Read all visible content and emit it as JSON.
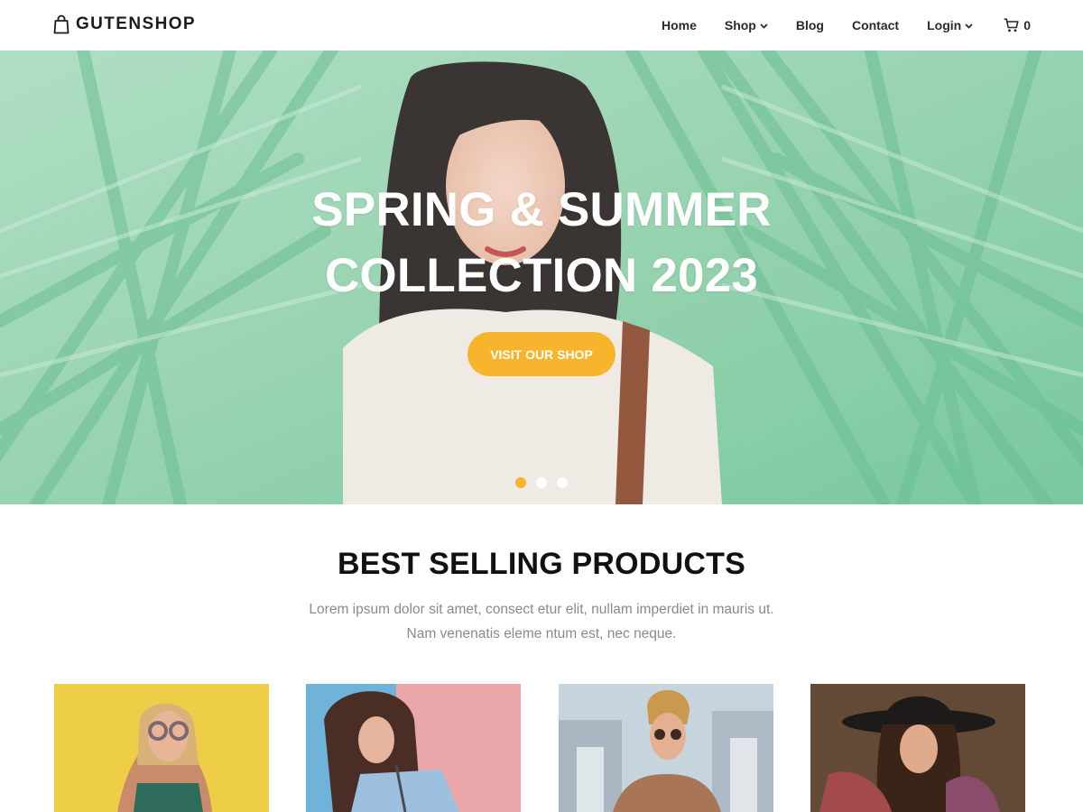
{
  "header": {
    "logo_text": "GUTENSHOP",
    "logo_icon": "shopping-bag-icon",
    "nav": [
      {
        "label": "Home",
        "has_dropdown": false
      },
      {
        "label": "Shop",
        "has_dropdown": true
      },
      {
        "label": "Blog",
        "has_dropdown": false
      },
      {
        "label": "Contact",
        "has_dropdown": false
      },
      {
        "label": "Login",
        "has_dropdown": true
      }
    ],
    "cart": {
      "icon": "cart-icon",
      "count": "0"
    }
  },
  "hero": {
    "title_line1": "SPRING & SUMMER",
    "title_line2": "COLLECTION 2023",
    "button_label": "VISIT OUR SHOP",
    "slides": 3,
    "active_slide": 1,
    "accent_color": "#f7b42c"
  },
  "section": {
    "title": "BEST SELLING PRODUCTS",
    "subtitle_line1": "Lorem ipsum dolor sit amet, consect etur elit, nullam imperdiet in mauris ut.",
    "subtitle_line2": "Nam venenatis eleme ntum est, nec neque."
  },
  "products": [
    {
      "image": "woman-with-sunglasses-yellow-wall"
    },
    {
      "image": "woman-denim-jacket-blue-pink-wall"
    },
    {
      "image": "man-sunglasses-city-background"
    },
    {
      "image": "woman-black-hat-wooden-background"
    }
  ]
}
